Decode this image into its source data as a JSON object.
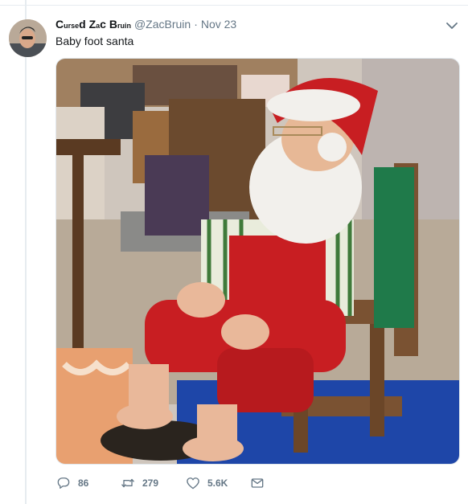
{
  "tweet": {
    "display_name_parts": [
      "C",
      "ursе",
      "d Z",
      "a",
      "c B",
      "ruin"
    ],
    "handle": "@ZacBruin",
    "separator": "·",
    "date": "Nov 23",
    "text": "Baby foot santa",
    "media_icon": "photo",
    "actions": {
      "reply": {
        "icon": "reply-icon",
        "count": "86"
      },
      "retweet": {
        "icon": "retweet-icon",
        "count": "279"
      },
      "like": {
        "icon": "heart-icon",
        "count": "5.6K"
      },
      "message": {
        "icon": "envelope-icon"
      }
    }
  },
  "colors": {
    "text_primary": "#14171a",
    "text_secondary": "#657786",
    "divider": "#e6ecf0",
    "santa_red": "#c81e22",
    "stripe_green": "#3f7a3a"
  }
}
